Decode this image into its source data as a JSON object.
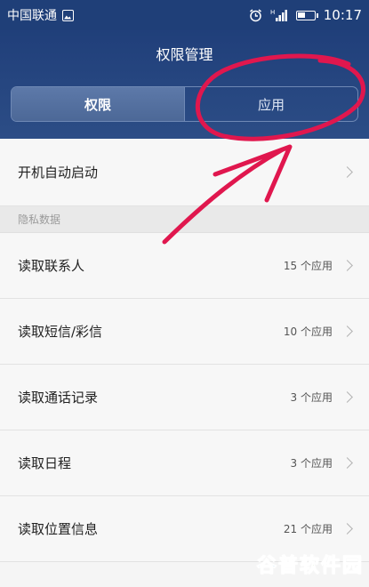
{
  "status_bar": {
    "carrier": "中国联通",
    "network": "H",
    "time": "10:17",
    "battery_level": 0.45
  },
  "header": {
    "title": "权限管理",
    "tabs": [
      {
        "label": "权限",
        "active": true
      },
      {
        "label": "应用",
        "active": false
      }
    ]
  },
  "list": {
    "autostart": {
      "label": "开机自动启动"
    },
    "section_title": "隐私数据",
    "items": [
      {
        "label": "读取联系人",
        "count": "15 个应用"
      },
      {
        "label": "读取短信/彩信",
        "count": "10 个应用"
      },
      {
        "label": "读取通话记录",
        "count": "3 个应用"
      },
      {
        "label": "读取日程",
        "count": "3 个应用"
      },
      {
        "label": "读取位置信息",
        "count": "21 个应用"
      }
    ]
  },
  "watermark": {
    "text": "谷普软件园",
    "colors": [
      "#2e9bd6",
      "#2e9bd6",
      "#78b82a",
      "#78b82a",
      "#78b82a"
    ]
  },
  "colors": {
    "header_bg": "#203f7a",
    "annotation": "#e0174e"
  }
}
